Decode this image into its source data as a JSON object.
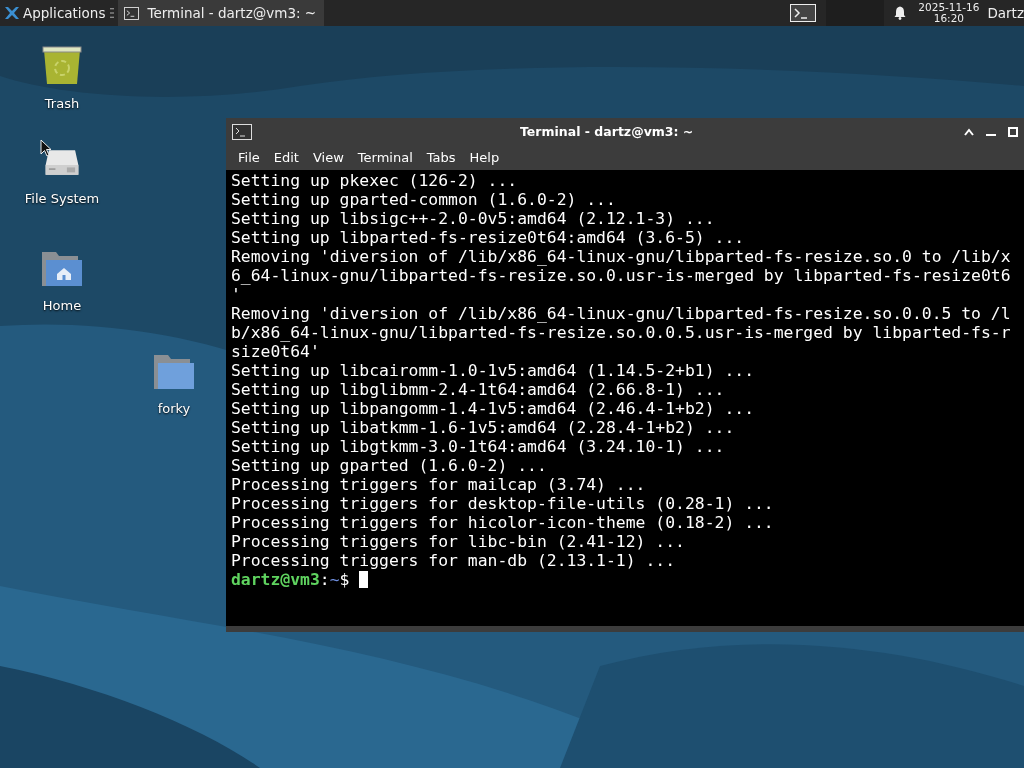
{
  "panel": {
    "apps_menu": "Applications",
    "tasks": [
      {
        "label": "Terminal - dartz@vm3: ~",
        "selected": true
      }
    ],
    "clock": {
      "date": "2025-11-16",
      "time": "16:20"
    },
    "user": "Dartz"
  },
  "desktop_icons": [
    {
      "label": "Trash",
      "kind": "trash"
    },
    {
      "label": "File System",
      "kind": "drive"
    },
    {
      "label": "Home",
      "kind": "home"
    },
    {
      "label": "forky",
      "kind": "folder"
    }
  ],
  "terminal": {
    "title": "Terminal - dartz@vm3: ~",
    "menu": [
      "File",
      "Edit",
      "View",
      "Terminal",
      "Tabs",
      "Help"
    ],
    "lines": [
      "Setting up pkexec (126-2) ...",
      "Setting up gparted-common (1.6.0-2) ...",
      "Setting up libsigc++-2.0-0v5:amd64 (2.12.1-3) ...",
      "Setting up libparted-fs-resize0t64:amd64 (3.6-5) ...",
      "Removing 'diversion of /lib/x86_64-linux-gnu/libparted-fs-resize.so.0 to /lib/x",
      "6_64-linux-gnu/libparted-fs-resize.so.0.usr-is-merged by libparted-fs-resize0t6",
      "'",
      "Removing 'diversion of /lib/x86_64-linux-gnu/libparted-fs-resize.so.0.0.5 to /l",
      "b/x86_64-linux-gnu/libparted-fs-resize.so.0.0.5.usr-is-merged by libparted-fs-r",
      "size0t64'",
      "Setting up libcairomm-1.0-1v5:amd64 (1.14.5-2+b1) ...",
      "Setting up libglibmm-2.4-1t64:amd64 (2.66.8-1) ...",
      "Setting up libpangomm-1.4-1v5:amd64 (2.46.4-1+b2) ...",
      "Setting up libatkmm-1.6-1v5:amd64 (2.28.4-1+b2) ...",
      "Setting up libgtkmm-3.0-1t64:amd64 (3.24.10-1) ...",
      "Setting up gparted (1.6.0-2) ...",
      "Processing triggers for mailcap (3.74) ...",
      "Processing triggers for desktop-file-utils (0.28-1) ...",
      "Processing triggers for hicolor-icon-theme (0.18-2) ...",
      "Processing triggers for libc-bin (2.41-12) ...",
      "Processing triggers for man-db (2.13.1-1) ..."
    ],
    "prompt": {
      "user_host": "dartz@vm3",
      "separator": ":",
      "path": "~",
      "symbol": "$"
    }
  }
}
